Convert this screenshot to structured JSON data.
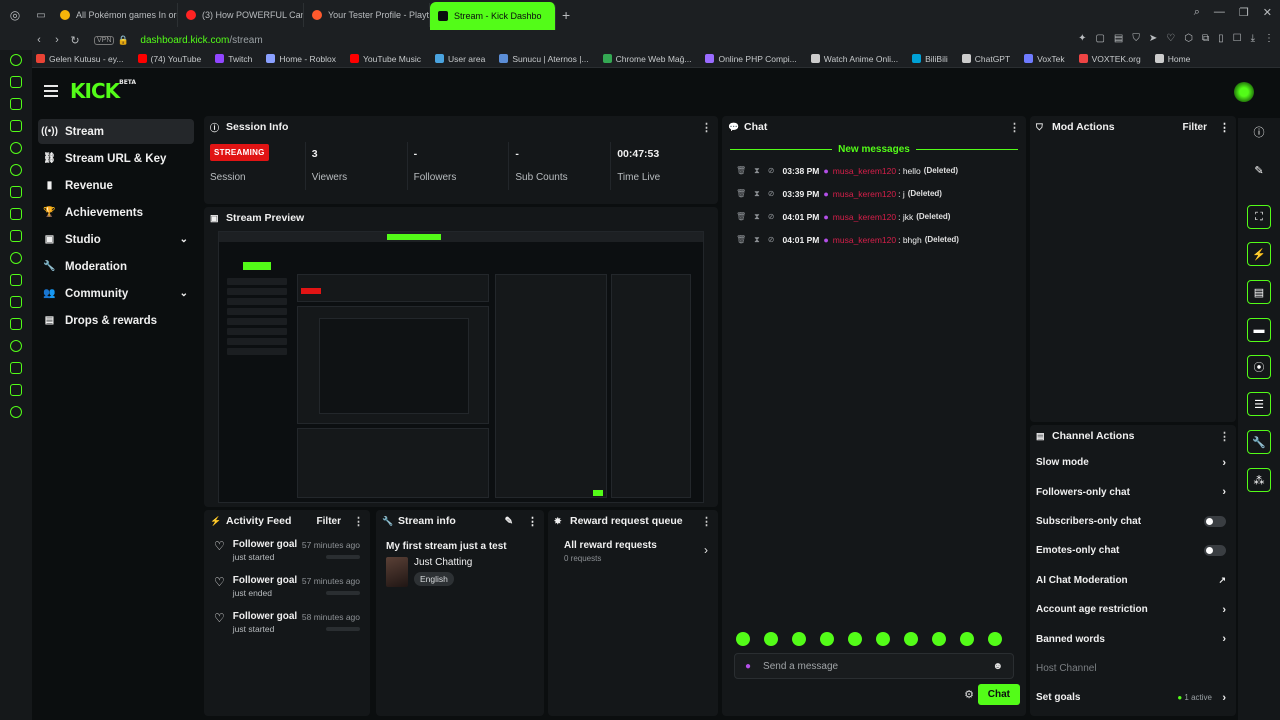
{
  "browser": {
    "tabs": [
      {
        "label": "All Pokémon games In ord",
        "color": "#f5b50a"
      },
      {
        "label": "(3) How POWERFUL Can",
        "color": "#ff2323"
      },
      {
        "label": "Your Tester Profile - Playt",
        "color": "#ff5a2d"
      },
      {
        "label": "Stream - Kick Dashbo",
        "color": "#53fc18"
      }
    ],
    "new_tab": "+",
    "url_host": "dashboard.kick.com",
    "url_path": "/stream",
    "vpn": "VPN",
    "bookmarks": [
      {
        "label": "Gelen Kutusu - ey...",
        "color": "#ea4335"
      },
      {
        "label": "(74) YouTube",
        "color": "#ff0000"
      },
      {
        "label": "Twitch",
        "color": "#9146ff"
      },
      {
        "label": "Home - Roblox",
        "color": "#8aa0ff"
      },
      {
        "label": "YouTube Music",
        "color": "#ff0000"
      },
      {
        "label": "User area",
        "color": "#4aa3df"
      },
      {
        "label": "Sunucu | Aternos |...",
        "color": "#5b8dd6"
      },
      {
        "label": "Chrome Web Mağ...",
        "color": "#34a853"
      },
      {
        "label": "Online PHP Compi...",
        "color": "#9a6bff"
      },
      {
        "label": "Watch Anime Onli...",
        "color": "#cccccc"
      },
      {
        "label": "BiliBili",
        "color": "#00a1d6"
      },
      {
        "label": "ChatGPT",
        "color": "#cccccc"
      },
      {
        "label": "VoxTek",
        "color": "#6f7bff"
      },
      {
        "label": "VOXTEK.org",
        "color": "#e44"
      },
      {
        "label": "Home",
        "color": "#cccccc"
      }
    ]
  },
  "brand": {
    "logo": "KICK",
    "beta": "BETA",
    "accent": "#53fc18"
  },
  "sidebar": {
    "items": [
      {
        "label": "Stream",
        "icon": "broadcast-icon",
        "glyph": "((•))"
      },
      {
        "label": "Stream URL & Key",
        "icon": "link-icon",
        "glyph": "⛓"
      },
      {
        "label": "Revenue",
        "icon": "chart-icon",
        "glyph": "▮"
      },
      {
        "label": "Achievements",
        "icon": "trophy-icon",
        "glyph": "🏆"
      },
      {
        "label": "Studio",
        "icon": "studio-icon",
        "glyph": "▣"
      },
      {
        "label": "Moderation",
        "icon": "wrench-icon",
        "glyph": "🔧"
      },
      {
        "label": "Community",
        "icon": "community-icon",
        "glyph": "👥"
      },
      {
        "label": "Drops & rewards",
        "icon": "drops-icon",
        "glyph": "▤"
      }
    ]
  },
  "session": {
    "title": "Session Info",
    "status_badge": "STREAMING",
    "status_label": "Session",
    "stats": [
      {
        "value": "3",
        "label": "Viewers"
      },
      {
        "value": "-",
        "label": "Followers"
      },
      {
        "value": "-",
        "label": "Sub Counts"
      },
      {
        "value": "00:47:53",
        "label": "Time Live"
      }
    ]
  },
  "preview": {
    "title": "Stream Preview"
  },
  "activity": {
    "title": "Activity Feed",
    "filter": "Filter",
    "items": [
      {
        "title": "Follower goal",
        "sub": "just started",
        "time": "57 minutes ago"
      },
      {
        "title": "Follower goal",
        "sub": "just ended",
        "time": "57 minutes ago"
      },
      {
        "title": "Follower goal",
        "sub": "just started",
        "time": "58 minutes ago"
      }
    ]
  },
  "stream_info": {
    "title": "Stream info",
    "stream_title": "My first stream just a test",
    "category": "Just Chatting",
    "language": "English"
  },
  "reward": {
    "title": "Reward request queue",
    "all_label": "All reward requests",
    "count": "0 requests"
  },
  "chat": {
    "title": "Chat",
    "new_messages": "New messages",
    "messages": [
      {
        "time": "03:38 PM",
        "user": "musa_kerem120",
        "text": ": hello",
        "deleted": "(Deleted)"
      },
      {
        "time": "03:39 PM",
        "user": "musa_kerem120",
        "text": ": j",
        "deleted": "(Deleted)"
      },
      {
        "time": "04:01 PM",
        "user": "musa_kerem120",
        "text": ": jkk",
        "deleted": "(Deleted)"
      },
      {
        "time": "04:01 PM",
        "user": "musa_kerem120",
        "text": ": bhgh",
        "deleted": "(Deleted)"
      }
    ],
    "placeholder": "Send a message",
    "send": "Chat"
  },
  "mod_actions": {
    "title": "Mod Actions",
    "filter": "Filter"
  },
  "channel_actions": {
    "title": "Channel Actions",
    "items": [
      {
        "label": "Slow mode",
        "control": "arrow"
      },
      {
        "label": "Followers-only chat",
        "control": "arrow"
      },
      {
        "label": "Subscribers-only chat",
        "control": "toggle"
      },
      {
        "label": "Emotes-only chat",
        "control": "toggle"
      },
      {
        "label": "AI Chat Moderation",
        "control": "external"
      },
      {
        "label": "Account age restriction",
        "control": "arrow"
      },
      {
        "label": "Banned words",
        "control": "arrow"
      },
      {
        "label": "Host Channel",
        "control": "none"
      },
      {
        "label": "Set goals",
        "control": "arrow"
      }
    ],
    "goals_active": "1 active"
  }
}
